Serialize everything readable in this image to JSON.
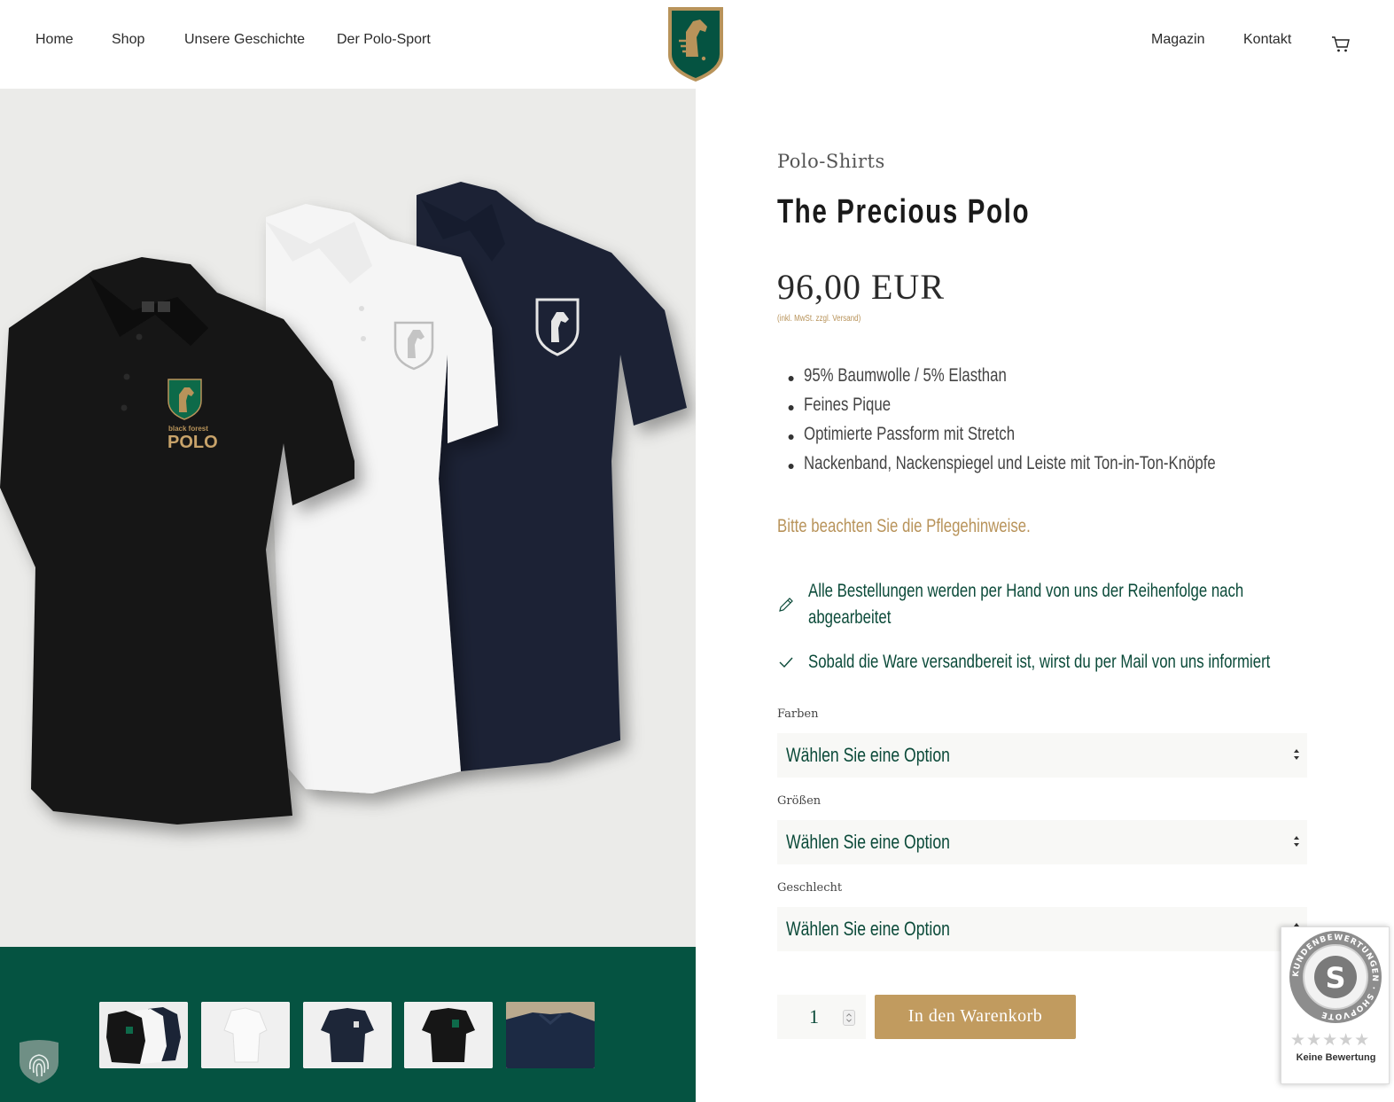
{
  "nav": {
    "left": [
      "Home",
      "Shop",
      "Unsere Geschichte",
      "Der Polo-Sport"
    ],
    "right": [
      "Magazin",
      "Kontakt"
    ]
  },
  "product": {
    "category": "Polo-Shirts",
    "title": "The Precious Polo",
    "price": "96,00 EUR",
    "price_note": "(inkl. MwSt. zzgl. Versand)",
    "features": [
      "95% Baumwolle / 5% Elasthan",
      "Feines Pique",
      "Optimierte Passform mit Stretch",
      "Nackenband, Nackenspiegel und Leiste mit Ton-in-Ton-Knöpfe"
    ],
    "care_link": "Bitte beachten Sie die Pflegehinweise.",
    "info": [
      {
        "icon": "pencil-icon",
        "text": "Alle Bestellungen werden per Hand von uns der Reihenfolge nach abgearbeitet"
      },
      {
        "icon": "check-icon",
        "text": "Sobald die Ware versandbereit ist, wirst du per Mail von uns informiert"
      }
    ],
    "options": [
      {
        "label": "Farben",
        "value": "Wählen Sie eine Option"
      },
      {
        "label": "Größen",
        "value": "Wählen Sie eine Option"
      },
      {
        "label": "Geschlecht",
        "value": "Wählen Sie eine Option"
      }
    ],
    "quantity": "1",
    "add_to_cart": "In den Warenkorb"
  },
  "logo_text": {
    "brand_line1": "black forest",
    "brand_line2": "POLO"
  },
  "shopvote": {
    "ring_text": "KUNDENBEWERTUNGEN · SHOPVOTE",
    "stars": "★★★★★",
    "label": "Keine Bewertung"
  },
  "colors": {
    "brand_green": "#055341",
    "gold": "#c19b5f",
    "text_green": "#0b4a39"
  }
}
